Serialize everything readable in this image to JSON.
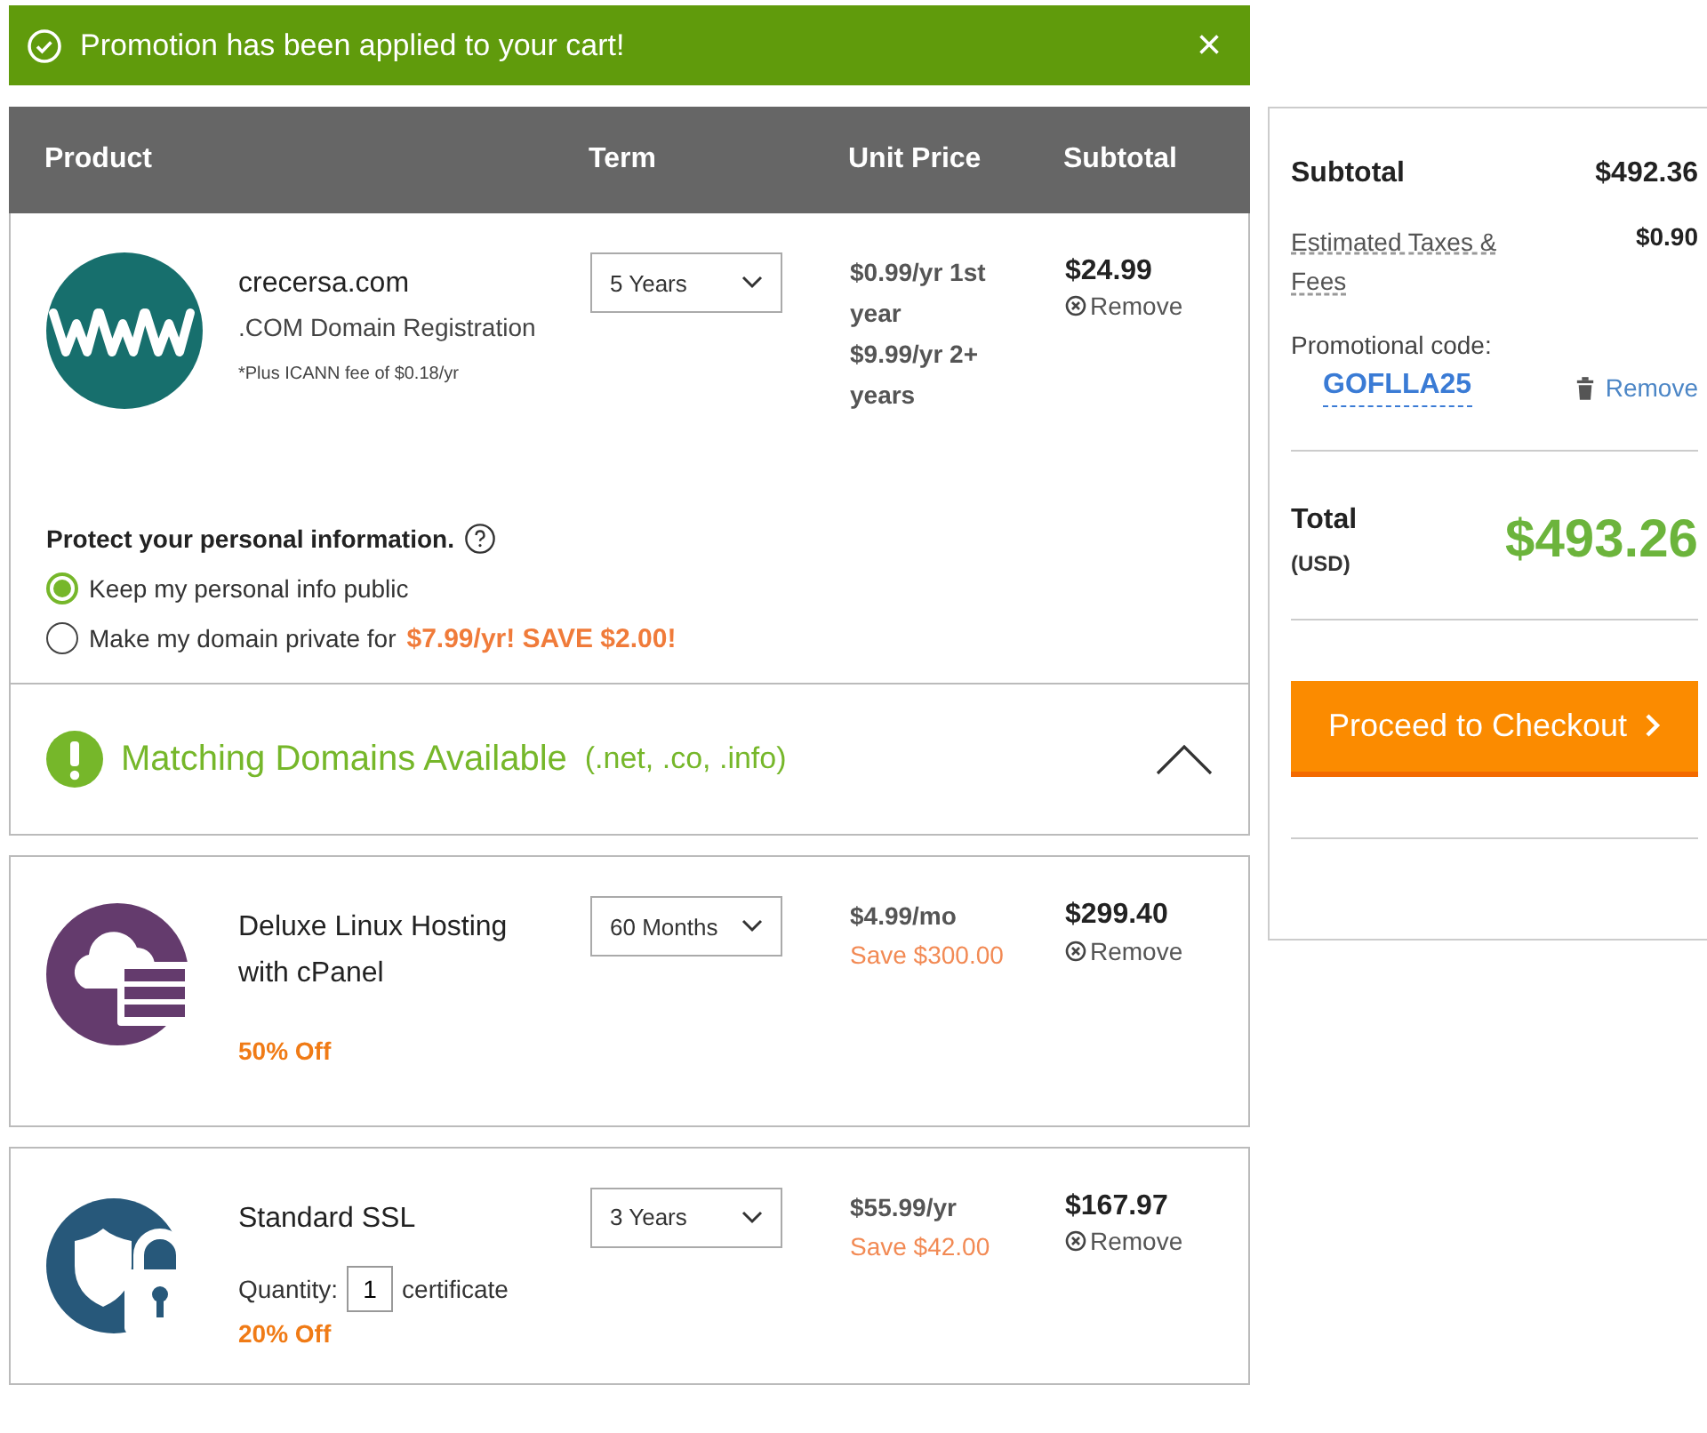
{
  "banner": {
    "message": "Promotion has been applied to your cart!",
    "close": "×"
  },
  "cart": {
    "columns": [
      "Product",
      "Term",
      "Unit Price",
      "Subtotal"
    ],
    "items": [
      {
        "kind": "domain",
        "name": "crecersa.com",
        "description": ".COM Domain Registration",
        "note": "*Plus ICANN fee of $0.18/yr",
        "term": "5 Years",
        "prices": [
          "$0.99/yr 1st year",
          "$9.99/yr 2+ years"
        ],
        "subtotal": "$24.99",
        "remove": "Remove",
        "privacy": {
          "title": "Protect your personal information.",
          "options": [
            {
              "label": "Keep my personal info public",
              "selected": true
            },
            {
              "label": "Make my domain private for",
              "offer": "$7.99/yr! SAVE $2.00!",
              "selected": false
            }
          ]
        },
        "matching": {
          "title": "Matching Domains Available",
          "extensions": "(.net, .co, .info)",
          "expanded": true
        }
      },
      {
        "kind": "hosting",
        "name": "Deluxe Linux Hosting with cPanel",
        "discount": "50% Off",
        "term": "60 Months",
        "prices": [
          "$4.99/mo"
        ],
        "save": "Save $300.00",
        "subtotal": "$299.40",
        "remove": "Remove"
      },
      {
        "kind": "ssl",
        "name": "Standard SSL",
        "quantity_label": "Quantity:",
        "quantity": "1",
        "quantity_unit": "certificate",
        "discount": "20% Off",
        "term": "3 Years",
        "prices": [
          "$55.99/yr"
        ],
        "save": "Save $42.00",
        "subtotal": "$167.97",
        "remove": "Remove"
      }
    ]
  },
  "summary": {
    "subtotal_label": "Subtotal",
    "subtotal": "$492.36",
    "taxes_label": "Estimated Taxes & Fees",
    "taxes": "$0.90",
    "promo_label": "Promotional code:",
    "promo_code": "GOFLLA25",
    "promo_remove": "Remove",
    "total_label": "Total",
    "currency": "(USD)",
    "total": "$493.26",
    "checkout": "Proceed to Checkout"
  }
}
